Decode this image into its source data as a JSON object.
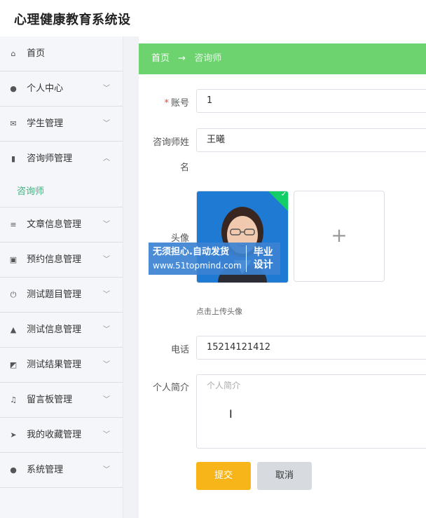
{
  "app": {
    "title": "心理健康教育系统设"
  },
  "sidebar": {
    "items": [
      {
        "label": "首页",
        "icon": "home-icon",
        "glyph": "⌂",
        "expandable": false
      },
      {
        "label": "个人中心",
        "icon": "user-icon",
        "glyph": "●",
        "expandable": true
      },
      {
        "label": "学生管理",
        "icon": "mail-icon",
        "glyph": "✉",
        "expandable": true
      },
      {
        "label": "咨询师管理",
        "icon": "chart-icon",
        "glyph": "▮",
        "expandable": true,
        "expanded": true,
        "children": [
          {
            "label": "咨询师"
          }
        ]
      },
      {
        "label": "文章信息管理",
        "icon": "list-icon",
        "glyph": "≡",
        "expandable": true
      },
      {
        "label": "预约信息管理",
        "icon": "clipboard-icon",
        "glyph": "▣",
        "expandable": true
      },
      {
        "label": "测试题目管理",
        "icon": "power-icon",
        "glyph": "⏻",
        "expandable": true
      },
      {
        "label": "测试信息管理",
        "icon": "person-icon",
        "glyph": "▲",
        "expandable": true
      },
      {
        "label": "测试结果管理",
        "icon": "trend-icon",
        "glyph": "◩",
        "expandable": true
      },
      {
        "label": "留言板管理",
        "icon": "mic-icon",
        "glyph": "♫",
        "expandable": true
      },
      {
        "label": "我的收藏管理",
        "icon": "send-icon",
        "glyph": "➤",
        "expandable": true
      },
      {
        "label": "系统管理",
        "icon": "user-icon",
        "glyph": "●",
        "expandable": true
      }
    ]
  },
  "breadcrumb": {
    "home": "首页",
    "separator": "→",
    "current": "咨询师"
  },
  "form": {
    "account_label": "账号",
    "required_mark": "*",
    "account_value": "1",
    "name_label_line1": "咨询师姓",
    "name_label_line2": "名",
    "name_value": "王曦",
    "avatar_label": "头像",
    "upload_glyph": "+",
    "upload_hint": "点击上传头像",
    "phone_label": "电话",
    "phone_value": "15214121412",
    "bio_label": "个人简介",
    "bio_placeholder": "个人简介",
    "submit_label": "提交",
    "cancel_label": "取消"
  },
  "watermark": {
    "line1": "无须担心.自动发货",
    "line2": "www.51topmind.com",
    "right_line1": "毕业",
    "right_line2": "设计"
  },
  "colors": {
    "breadcrumb_bg": "#6cd36f",
    "submit_bg": "#f7b519",
    "cancel_bg": "#d7dbe0",
    "active_sub": "#3fb27f"
  }
}
